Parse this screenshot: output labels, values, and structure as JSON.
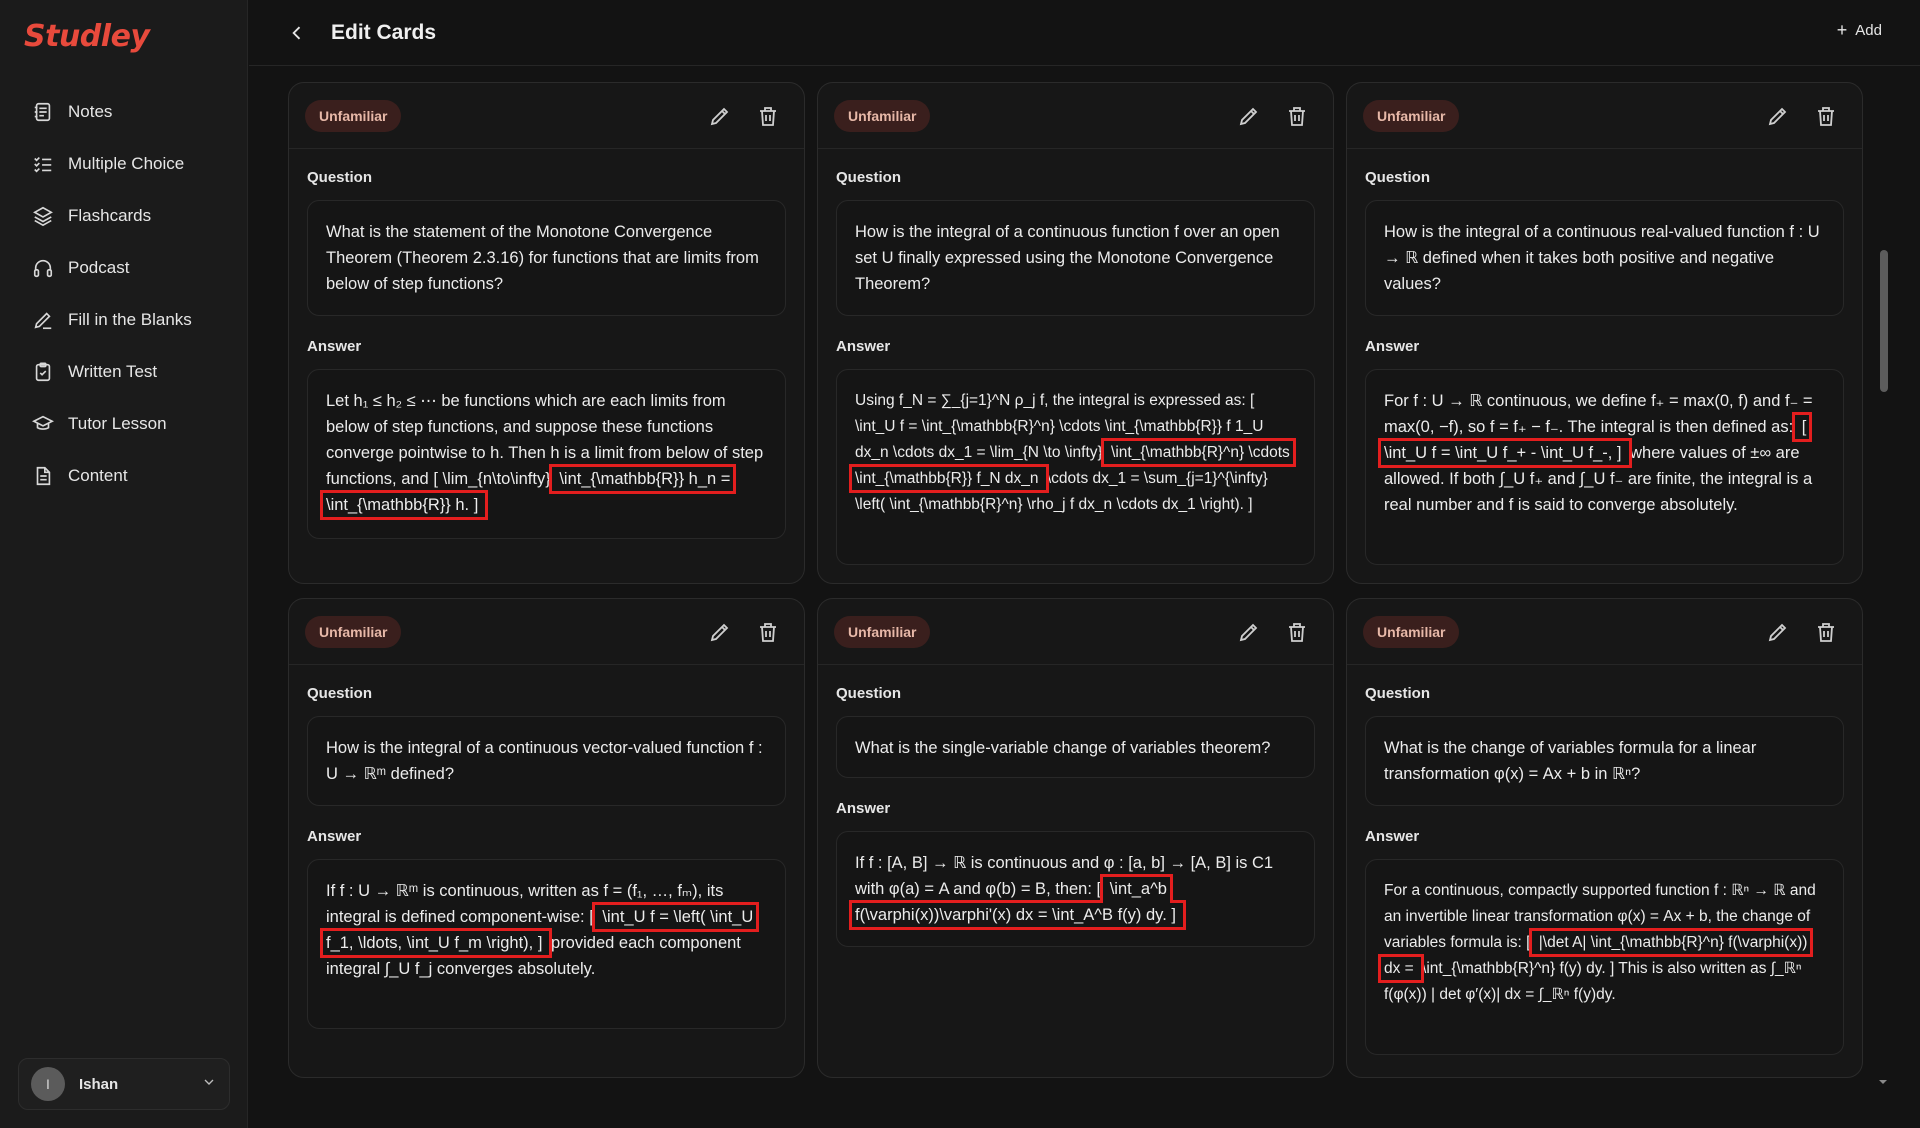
{
  "app": {
    "logo": "Studley"
  },
  "sidebar": {
    "items": [
      {
        "label": "Notes",
        "icon": "notes-icon"
      },
      {
        "label": "Multiple Choice",
        "icon": "checklist-icon"
      },
      {
        "label": "Flashcards",
        "icon": "layers-icon"
      },
      {
        "label": "Podcast",
        "icon": "headphones-icon"
      },
      {
        "label": "Fill in the Blanks",
        "icon": "pencil-icon"
      },
      {
        "label": "Written Test",
        "icon": "clipboard-icon"
      },
      {
        "label": "Tutor Lesson",
        "icon": "graduation-cap-icon"
      },
      {
        "label": "Content",
        "icon": "document-icon"
      }
    ],
    "user": {
      "initial": "I",
      "name": "Ishan"
    }
  },
  "header": {
    "title": "Edit Cards",
    "add_label": "Add"
  },
  "cards": [
    {
      "badge": "Unfamiliar",
      "question_label": "Question",
      "answer_label": "Answer",
      "question": "What is the statement of the Monotone Convergence Theorem (Theorem 2.3.16) for functions that are limits from below of step functions?",
      "a_pre": "Let h₁ ≤ h₂ ≤ ⋯ be functions which are each limits from below of step functions, and suppose these functions converge pointwise to h. Then h is a limit from below of step functions, and [ \\lim_{n\\to\\infty}",
      "a_hl": "\\int_{\\mathbb{R}} h_n = \\int_{\\mathbb{R}} h. ]",
      "a_post": ""
    },
    {
      "badge": "Unfamiliar",
      "question_label": "Question",
      "answer_label": "Answer",
      "question": "How is the integral of a continuous function f over an open set U finally expressed using the Monotone Convergence Theorem?",
      "a_pre": "Using f_N = ∑_{j=1}^N ρ_j f, the integral is expressed as: [ \\int_U f = \\int_{\\mathbb{R}^n} \\cdots \\int_{\\mathbb{R}} f 1_U dx_n \\cdots dx_1 = \\lim_{N \\to \\infty}",
      "a_hl": "\\int_{\\mathbb{R}^n} \\cdots \\int_{\\mathbb{R}} f_N dx_n",
      "a_post": "\\cdots dx_1 = \\sum_{j=1}^{\\infty} \\left( \\int_{\\mathbb{R}^n} \\rho_j f dx_n \\cdots dx_1 \\right). ]"
    },
    {
      "badge": "Unfamiliar",
      "question_label": "Question",
      "answer_label": "Answer",
      "question": "How is the integral of a continuous real-valued function f : U → ℝ defined when it takes both positive and negative values?",
      "a_pre": "For f : U → ℝ continuous, we define f₊ = max(0, f) and f₋ = max(0, −f), so f = f₊ − f₋. The integral is then defined as:",
      "a_hl": "[ \\int_U f = \\int_U f_+ - \\int_U f_-, ]",
      "a_post": "where values of ±∞ are allowed. If both ∫_U f₊ and ∫_U f₋ are finite, the integral is a real number and f is said to converge absolutely."
    },
    {
      "badge": "Unfamiliar",
      "question_label": "Question",
      "answer_label": "Answer",
      "question": "How is the integral of a continuous vector-valued function f : U → ℝᵐ defined?",
      "a_pre": "If f : U → ℝᵐ is continuous, written as f = (f₁, …, fₘ), its integral is defined component-wise: [",
      "a_hl": "\\int_U f = \\left( \\int_U f_1, \\ldots, \\int_U f_m \\right), ]",
      "a_post": "provided each component integral ∫_U f_j converges absolutely."
    },
    {
      "badge": "Unfamiliar",
      "question_label": "Question",
      "answer_label": "Answer",
      "question": "What is the single-variable change of variables theorem?",
      "a_pre": "If f : [A, B] → ℝ is continuous and φ : [a, b] → [A, B] is C1 with φ(a) = A and φ(b) = B, then: [",
      "a_hl": "\\int_a^b f(\\varphi(x))\\varphi'(x) dx = \\int_A^B f(y) dy. ]",
      "a_post": ""
    },
    {
      "badge": "Unfamiliar",
      "question_label": "Question",
      "answer_label": "Answer",
      "question": "What is the change of variables formula for a linear transformation φ(x) = Ax + b in ℝⁿ?",
      "a_pre": "For a continuous, compactly supported function f : ℝⁿ → ℝ and an invertible linear transformation φ(x) = Ax + b, the change of variables formula is: [",
      "a_hl": "|\\det A| \\int_{\\mathbb{R}^n} f(\\varphi(x)) dx =",
      "a_post": "\\int_{\\mathbb{R}^n} f(y) dy. ] This is also written as ∫_ℝⁿ f(φ(x)) | det φ′(x)| dx = ∫_ℝⁿ f(y)dy."
    }
  ]
}
